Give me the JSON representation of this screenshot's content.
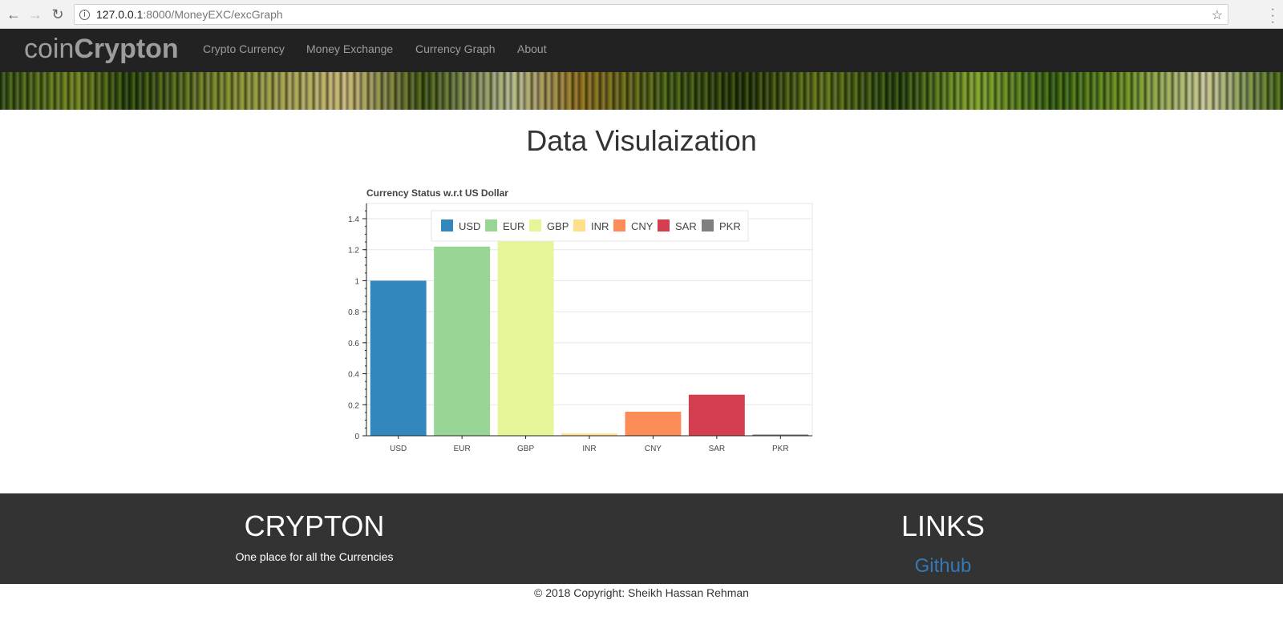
{
  "browser": {
    "url_host": "127.0.0.1",
    "url_path": ":8000/MoneyEXC/excGraph"
  },
  "navbar": {
    "brand_light": "coin",
    "brand_bold": "Crypton",
    "links": [
      "Crypto Currency",
      "Money Exchange",
      "Currency Graph",
      "About"
    ]
  },
  "page": {
    "title": "Data Visulaization"
  },
  "chart_data": {
    "type": "bar",
    "title": "Currency Status w.r.t US Dollar",
    "categories": [
      "USD",
      "EUR",
      "GBP",
      "INR",
      "CNY",
      "SAR",
      "PKR"
    ],
    "values": [
      1.0,
      1.22,
      1.4,
      0.014,
      0.155,
      0.265,
      0.008
    ],
    "colors": [
      "#3288bd",
      "#99d594",
      "#e6f598",
      "#fee08b",
      "#fc8d59",
      "#d53e4f",
      "#7f7f7f"
    ],
    "ylim": [
      0,
      1.5
    ],
    "yticks": [
      "0",
      "0.2",
      "0.4",
      "0.6",
      "0.8",
      "1",
      "1.2",
      "1.4"
    ],
    "legend_position": "top-center",
    "grid": true
  },
  "footer": {
    "brand_title": "CRYPTON",
    "brand_tagline": "One place for all the Currencies",
    "links_title": "LINKS",
    "github_label": "Github",
    "copyright": "© 2018 Copyright: Sheikh Hassan Rehman"
  }
}
